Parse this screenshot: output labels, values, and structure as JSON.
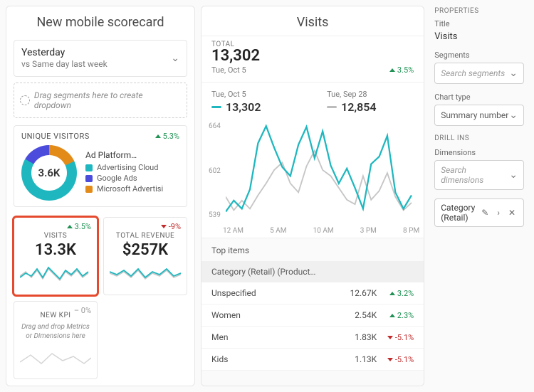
{
  "left": {
    "title": "New mobile scorecard",
    "date_primary": "Yesterday",
    "date_secondary": "vs Same day last week",
    "seg_drop_hint": "Drag segments here to create dropdown",
    "uv": {
      "header": "UNIQUE VISITORS",
      "trend": "5.3%",
      "value": "3.6K",
      "legend_title": "Ad Platform…",
      "legend": [
        {
          "label": "Advertising Cloud",
          "color": "#1fb7bf"
        },
        {
          "label": "Google Ads",
          "color": "#4b4bdc"
        },
        {
          "label": "Microsoft Advertisi",
          "color": "#e28b18"
        }
      ]
    },
    "kpis": {
      "visits": {
        "label": "VISITS",
        "value": "13.3K",
        "trend": "3.5%",
        "dir": "up"
      },
      "revenue": {
        "label": "TOTAL REVENUE",
        "value": "$257K",
        "trend": "-9%",
        "dir": "down"
      },
      "newkpi": {
        "label": "NEW KPI",
        "trend": "– 0%",
        "hint": "Drag and drop Metrics or Dimensions here"
      }
    }
  },
  "mid": {
    "title": "Visits",
    "total_label": "TOTAL",
    "total_value": "13,302",
    "total_date": "Tue, Oct 5",
    "total_trend": "3.5%",
    "cmpA": {
      "date": "Tue, Oct 5",
      "value": "13,302",
      "color": "#1fb7bf"
    },
    "cmpB": {
      "date": "Tue, Sep 28",
      "value": "12,854",
      "color": "#bcbcbc"
    },
    "yticks": [
      "664",
      "602",
      "539"
    ],
    "xticks": [
      "12 AM",
      "5 AM",
      "10 AM",
      "3 PM",
      "8 PM"
    ],
    "top_label": "Top items",
    "cat_header": "Category (Retail) (Product…",
    "items": [
      {
        "name": "Unspecified",
        "value": "12.67K",
        "pct": "3.2%",
        "dir": "up"
      },
      {
        "name": "Women",
        "value": "2.54K",
        "pct": "2.3%",
        "dir": "up"
      },
      {
        "name": "Men",
        "value": "1.83K",
        "pct": "-5.1%",
        "dir": "down"
      },
      {
        "name": "Kids",
        "value": "1.13K",
        "pct": "-5.1%",
        "dir": "down"
      }
    ]
  },
  "right": {
    "properties_label": "PROPERTIES",
    "title_label": "Title",
    "title_value": "Visits",
    "segments_label": "Segments",
    "segments_ph": "Search segments",
    "chart_type_label": "Chart type",
    "chart_type_value": "Summary number",
    "drillins_label": "DRILL INS",
    "dimensions_label": "Dimensions",
    "dimensions_ph": "Search dimensions",
    "tag_value": "Category (Retail)"
  },
  "chart_data": {
    "type": "line",
    "title": "Visits",
    "xlabel": "",
    "ylabel": "",
    "ylim": [
      539,
      664
    ],
    "x": [
      "12 AM",
      "1",
      "2",
      "3",
      "4",
      "5 AM",
      "6",
      "7",
      "8",
      "9",
      "10 AM",
      "11",
      "12",
      "1",
      "2",
      "3 PM",
      "4",
      "5",
      "6",
      "7",
      "8 PM",
      "9",
      "10",
      "11"
    ],
    "series": [
      {
        "name": "Tue, Oct 5",
        "color": "#1fb7bf",
        "values": [
          540,
          555,
          545,
          570,
          630,
          655,
          625,
          602,
          590,
          630,
          655,
          615,
          650,
          605,
          580,
          600,
          575,
          545,
          605,
          615,
          645,
          570,
          545,
          565
        ]
      },
      {
        "name": "Tue, Sep 28",
        "color": "#bcbcbc",
        "values": [
          560,
          540,
          555,
          545,
          565,
          580,
          600,
          610,
          580,
          570,
          605,
          625,
          600,
          590,
          575,
          560,
          555,
          590,
          560,
          570,
          595,
          560,
          545,
          555
        ]
      }
    ]
  }
}
